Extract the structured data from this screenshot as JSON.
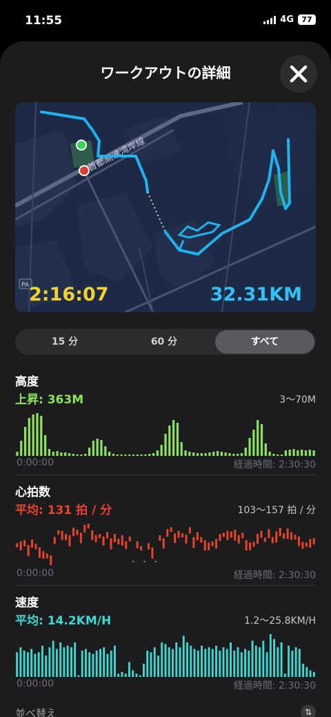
{
  "status_bar": {
    "time": "11:55",
    "network": "4G",
    "battery": "77"
  },
  "sheet": {
    "title": "ワークアウトの詳細"
  },
  "map": {
    "duration": "2:16:07",
    "distance": "32.31KM",
    "road_label": "首都高速湾岸線",
    "poi_label": "PA"
  },
  "range_tabs": [
    {
      "label": "15 分",
      "selected": false
    },
    {
      "label": "60 分",
      "selected": false
    },
    {
      "label": "すべて",
      "selected": true
    }
  ],
  "elevation": {
    "title": "高度",
    "value": "上昇: 363M",
    "range": "3～70M",
    "start": "0:00:00",
    "end": "経過時間: 2:30:30",
    "color": "#8fe35a",
    "values": [
      6,
      22,
      42,
      55,
      60,
      62,
      58,
      30,
      10,
      6,
      7,
      5,
      5,
      4,
      3,
      2,
      2,
      3,
      12,
      22,
      25,
      23,
      14,
      6,
      3,
      2,
      1,
      1,
      1,
      1,
      1,
      2,
      2,
      3,
      4,
      8,
      16,
      32,
      44,
      52,
      48,
      20,
      8,
      6,
      5,
      4,
      4,
      4,
      5,
      6,
      7,
      6,
      5,
      4,
      3,
      3,
      4,
      12,
      26,
      38,
      52,
      46,
      18,
      6,
      3,
      2,
      2,
      8,
      9,
      10,
      8,
      9,
      8,
      9,
      8
    ]
  },
  "heart_rate": {
    "title": "心拍数",
    "value": "平均: 131 拍 / 分",
    "range": "103～157 拍 / 分",
    "start": "0:00:00",
    "end": "経過時間: 2:30:30",
    "color": "#e8442a",
    "values": [
      125,
      128,
      130,
      122,
      131,
      124,
      118,
      112,
      108,
      105,
      135,
      146,
      145,
      140,
      138,
      150,
      147,
      142,
      155,
      157,
      146,
      138,
      140,
      136,
      143,
      133,
      140,
      132,
      138,
      128,
      136,
      0,
      128,
      120,
      0,
      125,
      118,
      0,
      138,
      133,
      148,
      151,
      141,
      145,
      141,
      139,
      151,
      135,
      143,
      135,
      130,
      126,
      128,
      132,
      140,
      142,
      145,
      144,
      147,
      138,
      142,
      130,
      126,
      127,
      140,
      145,
      134,
      148,
      135,
      144,
      150,
      141,
      149,
      143,
      139,
      136,
      127,
      126,
      132,
      133
    ]
  },
  "speed": {
    "title": "速度",
    "value": "平均: 14.2KM/H",
    "range": "1.2～25.8KM/H",
    "start": "0:00:00",
    "end": "経過時間: 2:30:30",
    "color": "#3ed8d2",
    "values": [
      15,
      18,
      16,
      15,
      17,
      14,
      15,
      19,
      13,
      18,
      22,
      17,
      21,
      18,
      19,
      18,
      21,
      1,
      16,
      17,
      15,
      14,
      16,
      17,
      18,
      14,
      16,
      19,
      2,
      3,
      2,
      9,
      4,
      2,
      1,
      8,
      16,
      15,
      18,
      13,
      21,
      20,
      18,
      17,
      21,
      18,
      25,
      21,
      19,
      17,
      16,
      19,
      17,
      18,
      17,
      19,
      16,
      18,
      17,
      21,
      16,
      18,
      15,
      17,
      16,
      22,
      19,
      18,
      22,
      15,
      26,
      23,
      18,
      21,
      2,
      19,
      16,
      18,
      17,
      8,
      6,
      4,
      3
    ]
  },
  "sort": {
    "label": "並べ替え"
  }
}
